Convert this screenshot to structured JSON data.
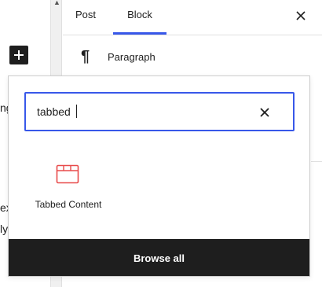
{
  "canvas": {
    "text_fragments": [
      "ng",
      "ex",
      "ly"
    ]
  },
  "sidebar": {
    "tabs": [
      {
        "label": "Post",
        "active": false
      },
      {
        "label": "Block",
        "active": true
      }
    ],
    "block_card": {
      "icon": "paragraph-icon",
      "title": "Paragraph"
    },
    "accent_color": "#3858e9"
  },
  "inserter": {
    "search": {
      "value": "tabbed",
      "placeholder": "Search"
    },
    "results": [
      {
        "label": "Tabbed Content",
        "icon": "tabbed-content-icon",
        "icon_color": "#e84b4b"
      }
    ],
    "browse_all_label": "Browse all"
  }
}
